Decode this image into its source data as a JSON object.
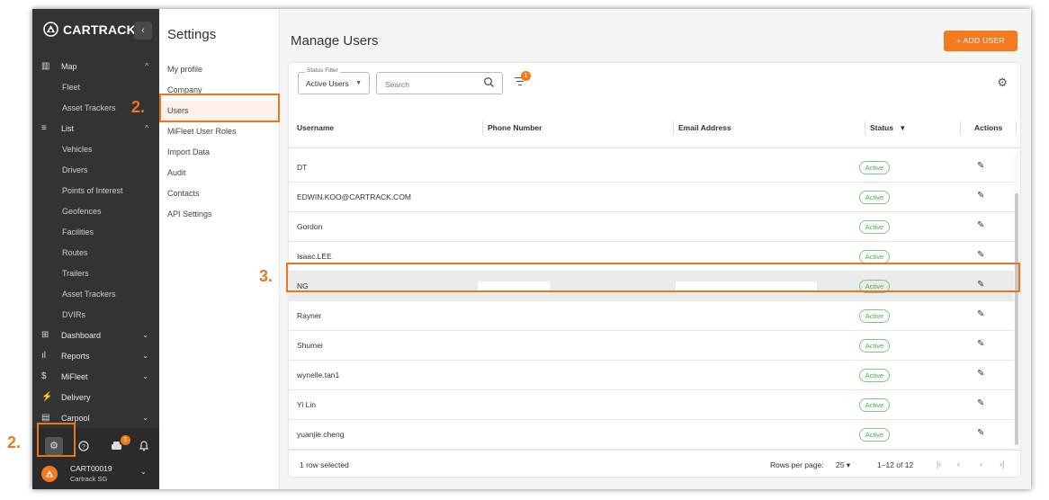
{
  "brand": {
    "name": "CARTRACK",
    "collapse_icon": "chevron-left-icon"
  },
  "sidebar": {
    "items": [
      {
        "type": "group",
        "icon": "map-icon",
        "glyph": "▥",
        "label": "Map",
        "chevron": "^"
      },
      {
        "type": "sub",
        "label": "Fleet"
      },
      {
        "type": "sub",
        "label": "Asset Trackers"
      },
      {
        "type": "group",
        "icon": "list-icon",
        "glyph": "≡",
        "label": "List",
        "chevron": "^"
      },
      {
        "type": "sub",
        "label": "Vehicles"
      },
      {
        "type": "sub",
        "label": "Drivers"
      },
      {
        "type": "sub",
        "label": "Points of Interest"
      },
      {
        "type": "sub",
        "label": "Geofences"
      },
      {
        "type": "sub",
        "label": "Facilities"
      },
      {
        "type": "sub",
        "label": "Routes"
      },
      {
        "type": "sub",
        "label": "Trailers"
      },
      {
        "type": "sub",
        "label": "Asset Trackers"
      },
      {
        "type": "sub",
        "label": "DVIRs"
      },
      {
        "type": "group",
        "icon": "dashboard-icon",
        "glyph": "⊞",
        "label": "Dashboard",
        "chevron": "⌄"
      },
      {
        "type": "group",
        "icon": "reports-icon",
        "glyph": "ıl",
        "label": "Reports",
        "chevron": "⌄"
      },
      {
        "type": "group",
        "icon": "dollar-icon",
        "glyph": "$",
        "label": "MiFleet",
        "chevron": "⌄"
      },
      {
        "type": "group",
        "icon": "delivery-icon",
        "glyph": "⚡",
        "label": "Delivery",
        "chevron": ""
      },
      {
        "type": "group",
        "icon": "carpool-icon",
        "glyph": "▤",
        "label": "Carpool",
        "chevron": "⌄"
      }
    ],
    "bottom": {
      "settings_glyph": "⚙",
      "help_glyph": "?",
      "alerts_badge": "1",
      "bell_glyph": "🔔"
    },
    "account": {
      "id": "CART00019",
      "name": "Cartrack SG"
    }
  },
  "settings": {
    "title": "Settings",
    "items": [
      "My profile",
      "Company",
      "Users",
      "MiFleet User Roles",
      "Import Data",
      "Audit",
      "Contacts",
      "API Settings"
    ]
  },
  "main": {
    "title": "Manage Users",
    "add_user_label": "+ ADD USER",
    "status_filter": {
      "legend": "Status Filter",
      "value": "Active Users"
    },
    "search_placeholder": "Search",
    "filter_badge": "1",
    "columns": [
      "Username",
      "Phone Number",
      "Email Address",
      "Status",
      "Actions"
    ],
    "rows": [
      {
        "username": "DT",
        "status": "Active"
      },
      {
        "username": "EDWIN.KOO@CARTRACK.COM",
        "status": "Active"
      },
      {
        "username": "Gordon",
        "status": "Active"
      },
      {
        "username": "Isaac.LEE",
        "status": "Active"
      },
      {
        "username": "NG",
        "status": "Active",
        "selected": true
      },
      {
        "username": "Rayner",
        "status": "Active"
      },
      {
        "username": "Shumei",
        "status": "Active"
      },
      {
        "username": "wynelle.tan1",
        "status": "Active"
      },
      {
        "username": "Yi Lin",
        "status": "Active"
      },
      {
        "username": "yuanjie.cheng",
        "status": "Active"
      }
    ],
    "footer": {
      "selected_text": "1 row selected",
      "rows_per_page_label": "Rows per page:",
      "rows_per_page_value": "25 ▾",
      "range": "1–12 of 12"
    }
  },
  "annotations": [
    "2.",
    "2.",
    "3."
  ],
  "colors": {
    "accent": "#f47a20",
    "sidebar": "#333333",
    "active_status": "#4caf50"
  }
}
